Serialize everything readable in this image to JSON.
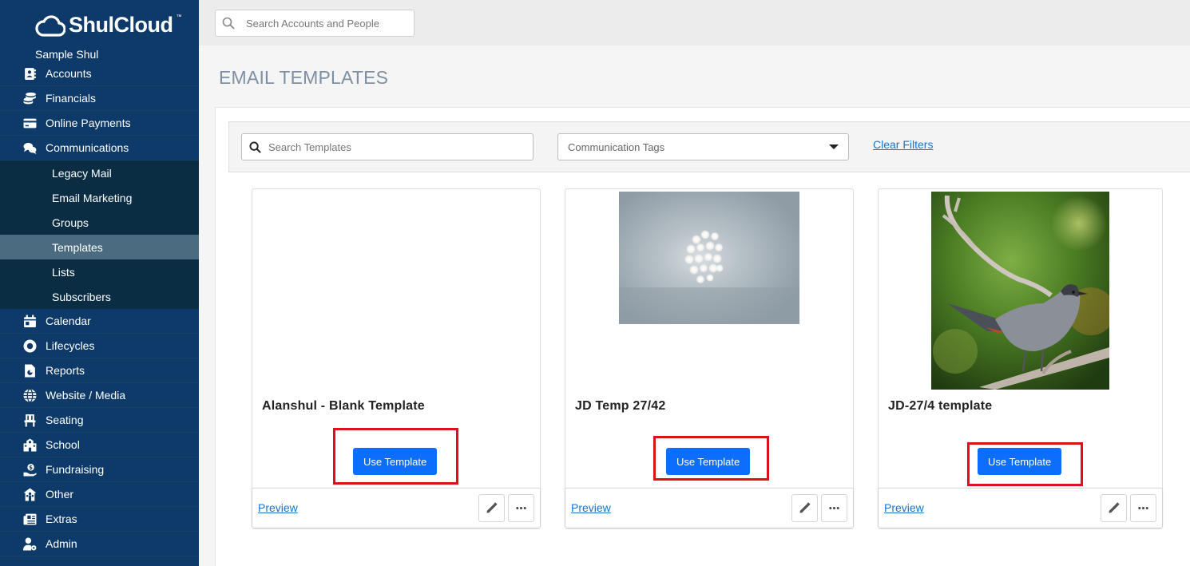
{
  "app": {
    "logo_text": "ShulCloud",
    "logo_tm": "™",
    "org_name": "Sample Shul"
  },
  "sidebar": {
    "items_top": [
      {
        "label": "Accounts",
        "icon": "address-book-icon"
      },
      {
        "label": "Financials",
        "icon": "coins-icon"
      },
      {
        "label": "Online Payments",
        "icon": "credit-card-icon"
      },
      {
        "label": "Communications",
        "icon": "comments-icon"
      }
    ],
    "submenu": [
      {
        "label": "Legacy Mail",
        "active": false
      },
      {
        "label": "Email Marketing",
        "active": false
      },
      {
        "label": "Groups",
        "active": false
      },
      {
        "label": "Templates",
        "active": true
      },
      {
        "label": "Lists",
        "active": false
      },
      {
        "label": "Subscribers",
        "active": false
      }
    ],
    "items_bottom": [
      {
        "label": "Calendar",
        "icon": "calendar-icon"
      },
      {
        "label": "Lifecycles",
        "icon": "life-ring-icon"
      },
      {
        "label": "Reports",
        "icon": "report-icon"
      },
      {
        "label": "Website / Media",
        "icon": "globe-icon"
      },
      {
        "label": "Seating",
        "icon": "chair-icon"
      },
      {
        "label": "School",
        "icon": "school-icon"
      },
      {
        "label": "Fundraising",
        "icon": "hand-holding-dollar-icon"
      },
      {
        "label": "Other",
        "icon": "people-roof-icon"
      },
      {
        "label": "Extras",
        "icon": "newspaper-icon"
      },
      {
        "label": "Admin",
        "icon": "users-cog-icon"
      }
    ]
  },
  "topbar": {
    "search_placeholder": "Search Accounts and People"
  },
  "page": {
    "title": "EMAIL TEMPLATES"
  },
  "filters": {
    "search_placeholder": "Search Templates",
    "tags_placeholder": "Communication Tags",
    "clear_label": "Clear Filters"
  },
  "cards": [
    {
      "name": "Alanshul - Blank Template",
      "use_label": "Use Template",
      "preview_label": "Preview",
      "thumb": "none"
    },
    {
      "name": "JD Temp 27/42",
      "use_label": "Use Template",
      "preview_label": "Preview",
      "thumb": "lights"
    },
    {
      "name": "JD-27/4 template",
      "use_label": "Use Template",
      "preview_label": "Preview",
      "thumb": "bird"
    }
  ],
  "colors": {
    "sidebar_bg": "#0d3a68",
    "submenu_bg": "#0b2d44",
    "active_bg": "#4a6b80",
    "primary_button": "#0d6efd",
    "highlight": "#e0101a",
    "link": "#1a73c9"
  }
}
